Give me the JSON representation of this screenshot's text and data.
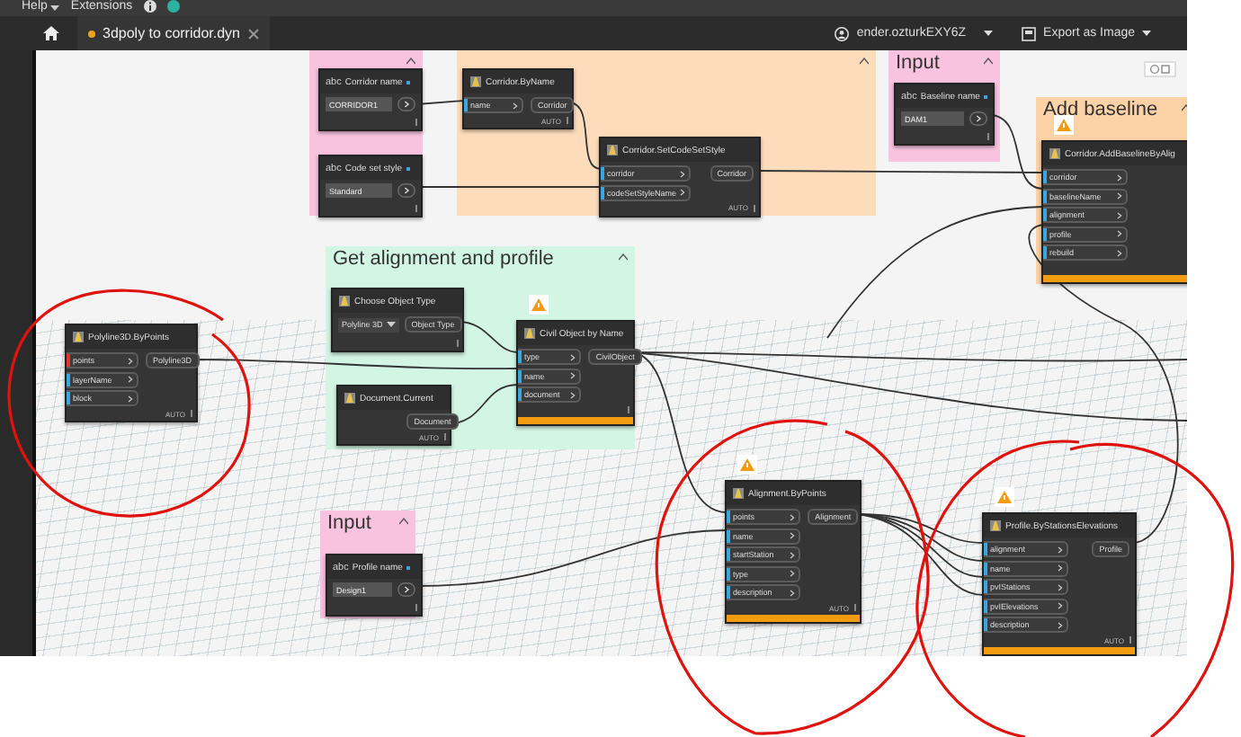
{
  "menu": [
    {
      "label": "Help",
      "has_menu": true
    },
    {
      "label": "Extensions",
      "has_menu": false
    }
  ],
  "tab": {
    "title": "3dpoly to corridor.dyn",
    "unsaved": true
  },
  "account": {
    "name": "ender.ozturkEXY6Z"
  },
  "export": {
    "label": "Export as Image"
  },
  "groups": [
    {
      "color": "#f9c3df"
    },
    {
      "color": "#fddcbc"
    },
    {
      "title": "Input",
      "color": "#f9c3df"
    },
    {
      "title": "Add baseline",
      "color": "#fdd2a6"
    },
    {
      "title": "Get alignment and profile",
      "color": "#d2f5e4"
    },
    {
      "title": "Input",
      "color": "#f9c3df"
    }
  ],
  "nodes": [
    {
      "kind": "string_input",
      "badge": "abc",
      "title": "Corridor name",
      "value": "CORRIDOR1",
      "warning": false
    },
    {
      "kind": "string_input",
      "badge": "abc",
      "title": "Code set style",
      "value": "Standard",
      "warning": false
    },
    {
      "kind": "function",
      "title": "Corridor.ByName",
      "inputs": [
        {
          "name": "name",
          "color": "#3aa6e0"
        }
      ],
      "outputs": [
        "Corridor"
      ],
      "lacing": "AUTO",
      "warning": false
    },
    {
      "kind": "function",
      "title": "Corridor.SetCodeSetStyle",
      "inputs": [
        {
          "name": "corridor",
          "color": "#3aa6e0"
        },
        {
          "name": "codeSetStyleName",
          "color": "#3aa6e0"
        }
      ],
      "outputs": [
        "Corridor"
      ],
      "lacing": "AUTO",
      "warning": false
    },
    {
      "kind": "string_input",
      "badge": "abc",
      "title": "Baseline name",
      "value": "DAM1",
      "warning": false
    },
    {
      "kind": "function",
      "title": "Corridor.AddBaselineByAlig",
      "inputs": [
        {
          "name": "corridor",
          "color": "#3aa6e0"
        },
        {
          "name": "baselineName",
          "color": "#3aa6e0"
        },
        {
          "name": "alignment",
          "color": "#3aa6e0"
        },
        {
          "name": "profile",
          "color": "#3aa6e0"
        },
        {
          "name": "rebuild",
          "color": "#3aa6e0"
        }
      ],
      "warning": true
    },
    {
      "kind": "dropdown",
      "title": "Choose Object Type",
      "value": "Polyline 3D",
      "outputs": [
        "Object Type"
      ],
      "warning": false
    },
    {
      "kind": "function",
      "title": "Civil Object by Name",
      "inputs": [
        {
          "name": "type",
          "color": "#3aa6e0"
        },
        {
          "name": "name",
          "color": "#3aa6e0"
        },
        {
          "name": "document",
          "color": "#3aa6e0"
        }
      ],
      "outputs": [
        "CivilObject"
      ],
      "warning": true
    },
    {
      "kind": "function",
      "title": "Document.Current",
      "outputs": [
        "Document"
      ],
      "lacing": "AUTO",
      "warning": false
    },
    {
      "kind": "function",
      "title": "Polyline3D.ByPoints",
      "inputs": [
        {
          "name": "points",
          "color": "#e0352b"
        },
        {
          "name": "layerName",
          "color": "#3aa6e0"
        },
        {
          "name": "block",
          "color": "#3aa6e0"
        }
      ],
      "outputs": [
        "Polyline3D"
      ],
      "lacing": "AUTO",
      "warning": false
    },
    {
      "kind": "string_input",
      "badge": "abc",
      "title": "Profile name",
      "value": "Design1",
      "warning": false
    },
    {
      "kind": "function",
      "title": "Alignment.ByPoints",
      "inputs": [
        {
          "name": "points",
          "color": "#3aa6e0"
        },
        {
          "name": "name",
          "color": "#3aa6e0"
        },
        {
          "name": "startStation",
          "color": "#3aa6e0"
        },
        {
          "name": "type",
          "color": "#3aa6e0"
        },
        {
          "name": "description",
          "color": "#3aa6e0"
        }
      ],
      "outputs": [
        "Alignment"
      ],
      "lacing": "AUTO",
      "warning": true
    },
    {
      "kind": "function",
      "title": "Profile.ByStationsElevations",
      "inputs": [
        {
          "name": "alignment",
          "color": "#3aa6e0"
        },
        {
          "name": "name",
          "color": "#3aa6e0"
        },
        {
          "name": "pvIStations",
          "color": "#3aa6e0"
        },
        {
          "name": "pvIElevations",
          "color": "#3aa6e0"
        },
        {
          "name": "description",
          "color": "#3aa6e0"
        }
      ],
      "outputs": [
        "Profile"
      ],
      "lacing": "AUTO",
      "warning": true
    }
  ]
}
